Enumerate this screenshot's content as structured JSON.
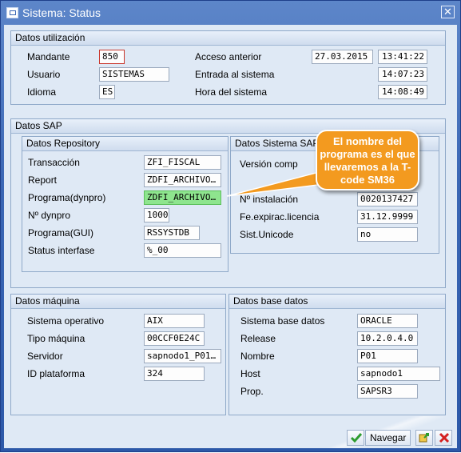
{
  "window": {
    "title": "Sistema: Status",
    "close_glyph": "✕"
  },
  "utilizacion": {
    "title": "Datos utilización",
    "mandante": {
      "label": "Mandante",
      "value": "850"
    },
    "usuario": {
      "label": "Usuario",
      "value": "SISTEMAS"
    },
    "idioma": {
      "label": "Idioma",
      "value": "ES"
    },
    "acceso_anterior": {
      "label": "Acceso anterior",
      "date": "27.03.2015",
      "time": "13:41:22"
    },
    "entrada_sistema": {
      "label": "Entrada al sistema",
      "time": "14:07:23"
    },
    "hora_sistema": {
      "label": "Hora del sistema",
      "time": "14:08:49"
    }
  },
  "sap": {
    "title": "Datos SAP",
    "repository": {
      "title": "Datos Repository",
      "rows": [
        {
          "label": "Transacción",
          "value": "ZFI_FISCAL"
        },
        {
          "label": "Report",
          "value": "ZDFI_ARCHIVO…"
        },
        {
          "label": "Programa(dynpro)",
          "value": "ZDFI_ARCHIVO…"
        },
        {
          "label": "Nº dynpro",
          "value": "1000"
        },
        {
          "label": "Programa(GUI)",
          "value": "RSSYSTDB"
        },
        {
          "label": "Status interfase",
          "value": "%_00"
        }
      ]
    },
    "sistema": {
      "title": "Datos Sistema SAP",
      "version": {
        "label": "Versión comp"
      },
      "instalacion": {
        "label": "Nº instalación",
        "value": "0020137427"
      },
      "expiracion": {
        "label": "Fe.expirac.licencia",
        "value": "31.12.9999"
      },
      "unicode": {
        "label": "Sist.Unicode",
        "value": "no"
      }
    },
    "callout": "El nombre del programa es el que llevaremos a la T-code SM36"
  },
  "maquina": {
    "title": "Datos máquina",
    "rows": [
      {
        "label": "Sistema operativo",
        "value": "AIX"
      },
      {
        "label": "Tipo máquina",
        "value": "00CCF0E24C"
      },
      {
        "label": "Servidor",
        "value": "sapnodo1_P01…"
      },
      {
        "label": "ID plataforma",
        "value": "324"
      }
    ]
  },
  "base_datos": {
    "title": "Datos base datos",
    "rows": [
      {
        "label": "Sistema base datos",
        "value": "ORACLE"
      },
      {
        "label": "Release",
        "value": "10.2.0.4.0"
      },
      {
        "label": "Nombre",
        "value": "P01"
      },
      {
        "label": "Host",
        "value": "sapnodo1"
      },
      {
        "label": "Prop.",
        "value": "SAPSR3"
      }
    ]
  },
  "footer": {
    "navegar_label": "Navegar",
    "icons": [
      "checkmark-icon",
      "navigate-icon",
      "cancel-icon"
    ],
    "colors": {
      "check": "#2e9c2e",
      "cancel": "#d42020",
      "callout": "#f39a1f",
      "highlight": "#8ee58e"
    }
  }
}
